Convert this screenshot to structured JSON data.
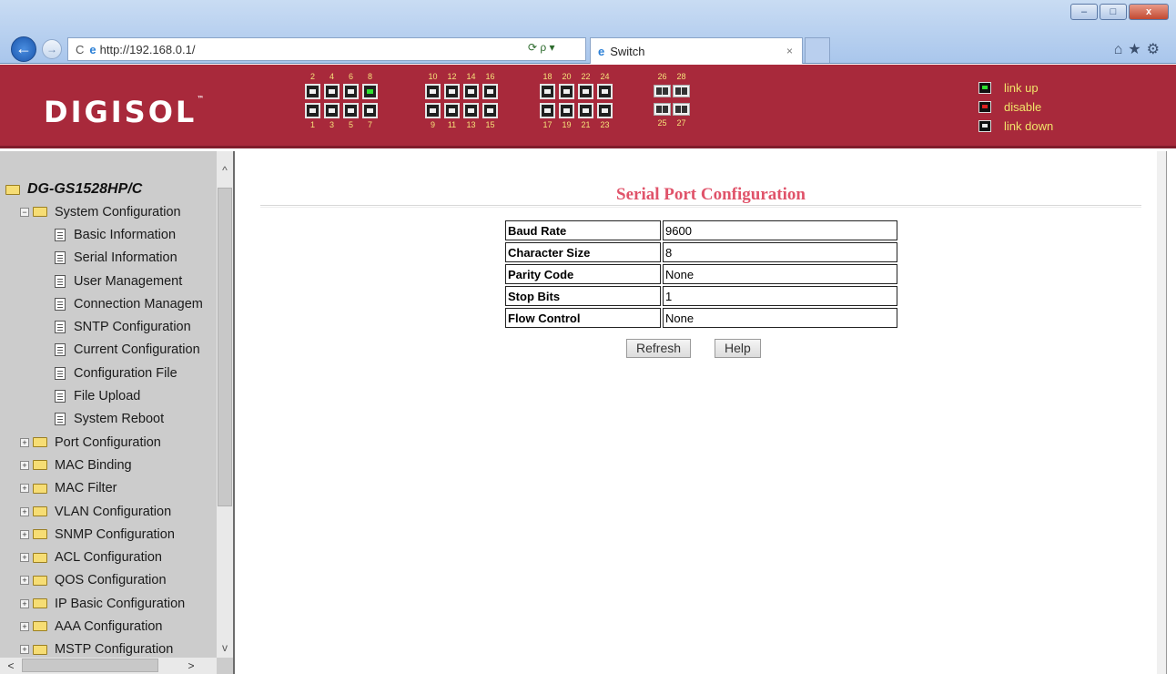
{
  "browser": {
    "url": "http://192.168.0.1/",
    "tab_title": "Switch",
    "tab_close": "×",
    "back": "←",
    "forward": "→",
    "reload": "C",
    "addr_tools": "⟳ ρ ▾",
    "window_controls": [
      "–",
      "□",
      "x"
    ],
    "toolbar_icons": "⌂★⚙"
  },
  "banner": {
    "logo": "DIGISOL",
    "logo_tm": "™",
    "port_groups": [
      {
        "top": [
          "2",
          "4",
          "6",
          "8"
        ],
        "bottom": [
          "1",
          "3",
          "5",
          "7"
        ],
        "up": [
          "8"
        ]
      },
      {
        "top": [
          "10",
          "12",
          "14",
          "16"
        ],
        "bottom": [
          "9",
          "11",
          "13",
          "15"
        ],
        "up": []
      },
      {
        "top": [
          "18",
          "20",
          "22",
          "24"
        ],
        "bottom": [
          "17",
          "19",
          "21",
          "23"
        ],
        "up": []
      },
      {
        "top": [
          "26",
          "28"
        ],
        "bottom": [
          "25",
          "27"
        ],
        "up": [],
        "sfp": true
      }
    ],
    "legend": [
      {
        "label": "link up",
        "color": "#2ee02e"
      },
      {
        "label": "disable",
        "color": "#e02020"
      },
      {
        "label": "link down",
        "color": "#e8e8e8"
      }
    ]
  },
  "sidebar": {
    "root": "DG-GS1528HP/C",
    "groups": [
      {
        "label": "System Configuration",
        "expanded": true,
        "exp_icon": "−",
        "children": [
          "Basic Information",
          "Serial Information",
          "User Management",
          "Connection Managem",
          "SNTP Configuration",
          "Current Configuration",
          "Configuration File",
          "File Upload",
          "System Reboot"
        ]
      },
      {
        "label": "Port Configuration",
        "exp_icon": "+"
      },
      {
        "label": "MAC Binding",
        "exp_icon": "+"
      },
      {
        "label": "MAC Filter",
        "exp_icon": "+"
      },
      {
        "label": "VLAN Configuration",
        "exp_icon": "+"
      },
      {
        "label": "SNMP Configuration",
        "exp_icon": "+"
      },
      {
        "label": "ACL Configuration",
        "exp_icon": "+"
      },
      {
        "label": "QOS Configuration",
        "exp_icon": "+"
      },
      {
        "label": "IP Basic Configuration",
        "exp_icon": "+"
      },
      {
        "label": "AAA Configuration",
        "exp_icon": "+"
      },
      {
        "label": "MSTP Configuration",
        "exp_icon": "+"
      }
    ],
    "scroll": {
      "up": "^",
      "down": "v",
      "left": "<",
      "right": ">"
    }
  },
  "main": {
    "title": "Serial Port Configuration",
    "rows": [
      {
        "key": "Baud Rate",
        "value": "9600"
      },
      {
        "key": "Character Size",
        "value": "8"
      },
      {
        "key": "Parity Code",
        "value": "None"
      },
      {
        "key": "Stop Bits",
        "value": "1"
      },
      {
        "key": "Flow Control",
        "value": "None"
      }
    ],
    "refresh_label": "Refresh",
    "help_label": "Help"
  }
}
